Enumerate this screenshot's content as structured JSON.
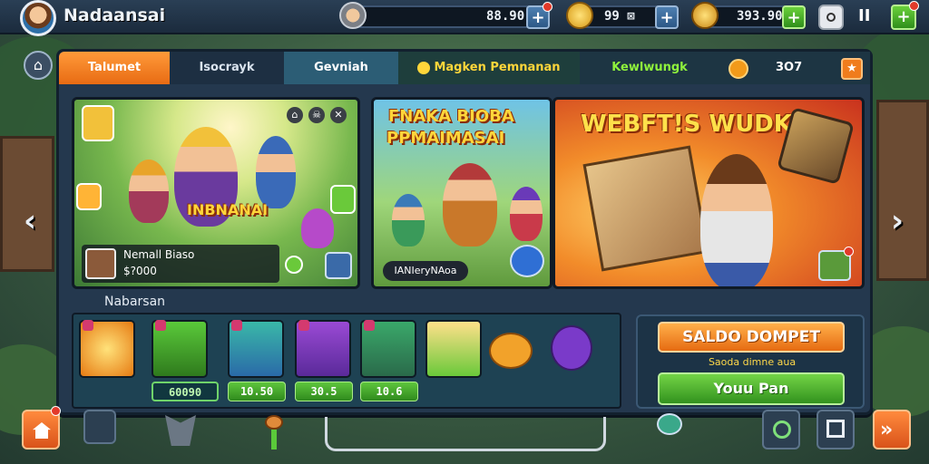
{
  "header": {
    "player_name": "Nadaansai",
    "resources": [
      {
        "name": "helmet-currency",
        "value": "88.90",
        "icon": "viking-helmet-icon"
      },
      {
        "name": "gold-ticket",
        "value": "99 ⊠",
        "icon": "gold-ticket-icon"
      },
      {
        "name": "coins",
        "value": "393.90",
        "icon": "coin-icon"
      }
    ],
    "settings_icon": "camera-icon",
    "pause_label": "II"
  },
  "tabs": [
    {
      "label": "Talumet"
    },
    {
      "label": "Isocrayk"
    },
    {
      "label": "Gevniah"
    },
    {
      "label": "Magken Pemnanan"
    },
    {
      "label": "Kewlwungk"
    }
  ],
  "tab_bar_extra": {
    "count": "3O7"
  },
  "cards": {
    "card1": {
      "banner": "INBNANAI",
      "name": "Nemall Biaso",
      "price": "$?000"
    },
    "card2": {
      "title_line1": "FNAKA BIOBA",
      "title_line2": "PPMAIMASAI",
      "caption": "IANIeryNAoa"
    },
    "card3": {
      "title": "WEBFT!S WUDK"
    }
  },
  "section": {
    "title": "Nabarsan"
  },
  "items": [
    {
      "name": "slot-treasure",
      "price": ""
    },
    {
      "name": "slot-goblin",
      "price": "60090"
    },
    {
      "name": "slot-pair",
      "price": ""
    },
    {
      "name": "slot-wizard",
      "price": "10.50"
    },
    {
      "name": "slot-kid",
      "price": "30.5"
    },
    {
      "name": "slot-cowboy",
      "price": "10.6"
    }
  ],
  "wallet": {
    "title": "SALDO DOMPET",
    "sub": "Saoda dimne aua",
    "pay": "Youu Pan"
  },
  "colors": {
    "accent_orange": "#e86b13",
    "accent_green": "#32921e",
    "panel": "#24384e"
  }
}
